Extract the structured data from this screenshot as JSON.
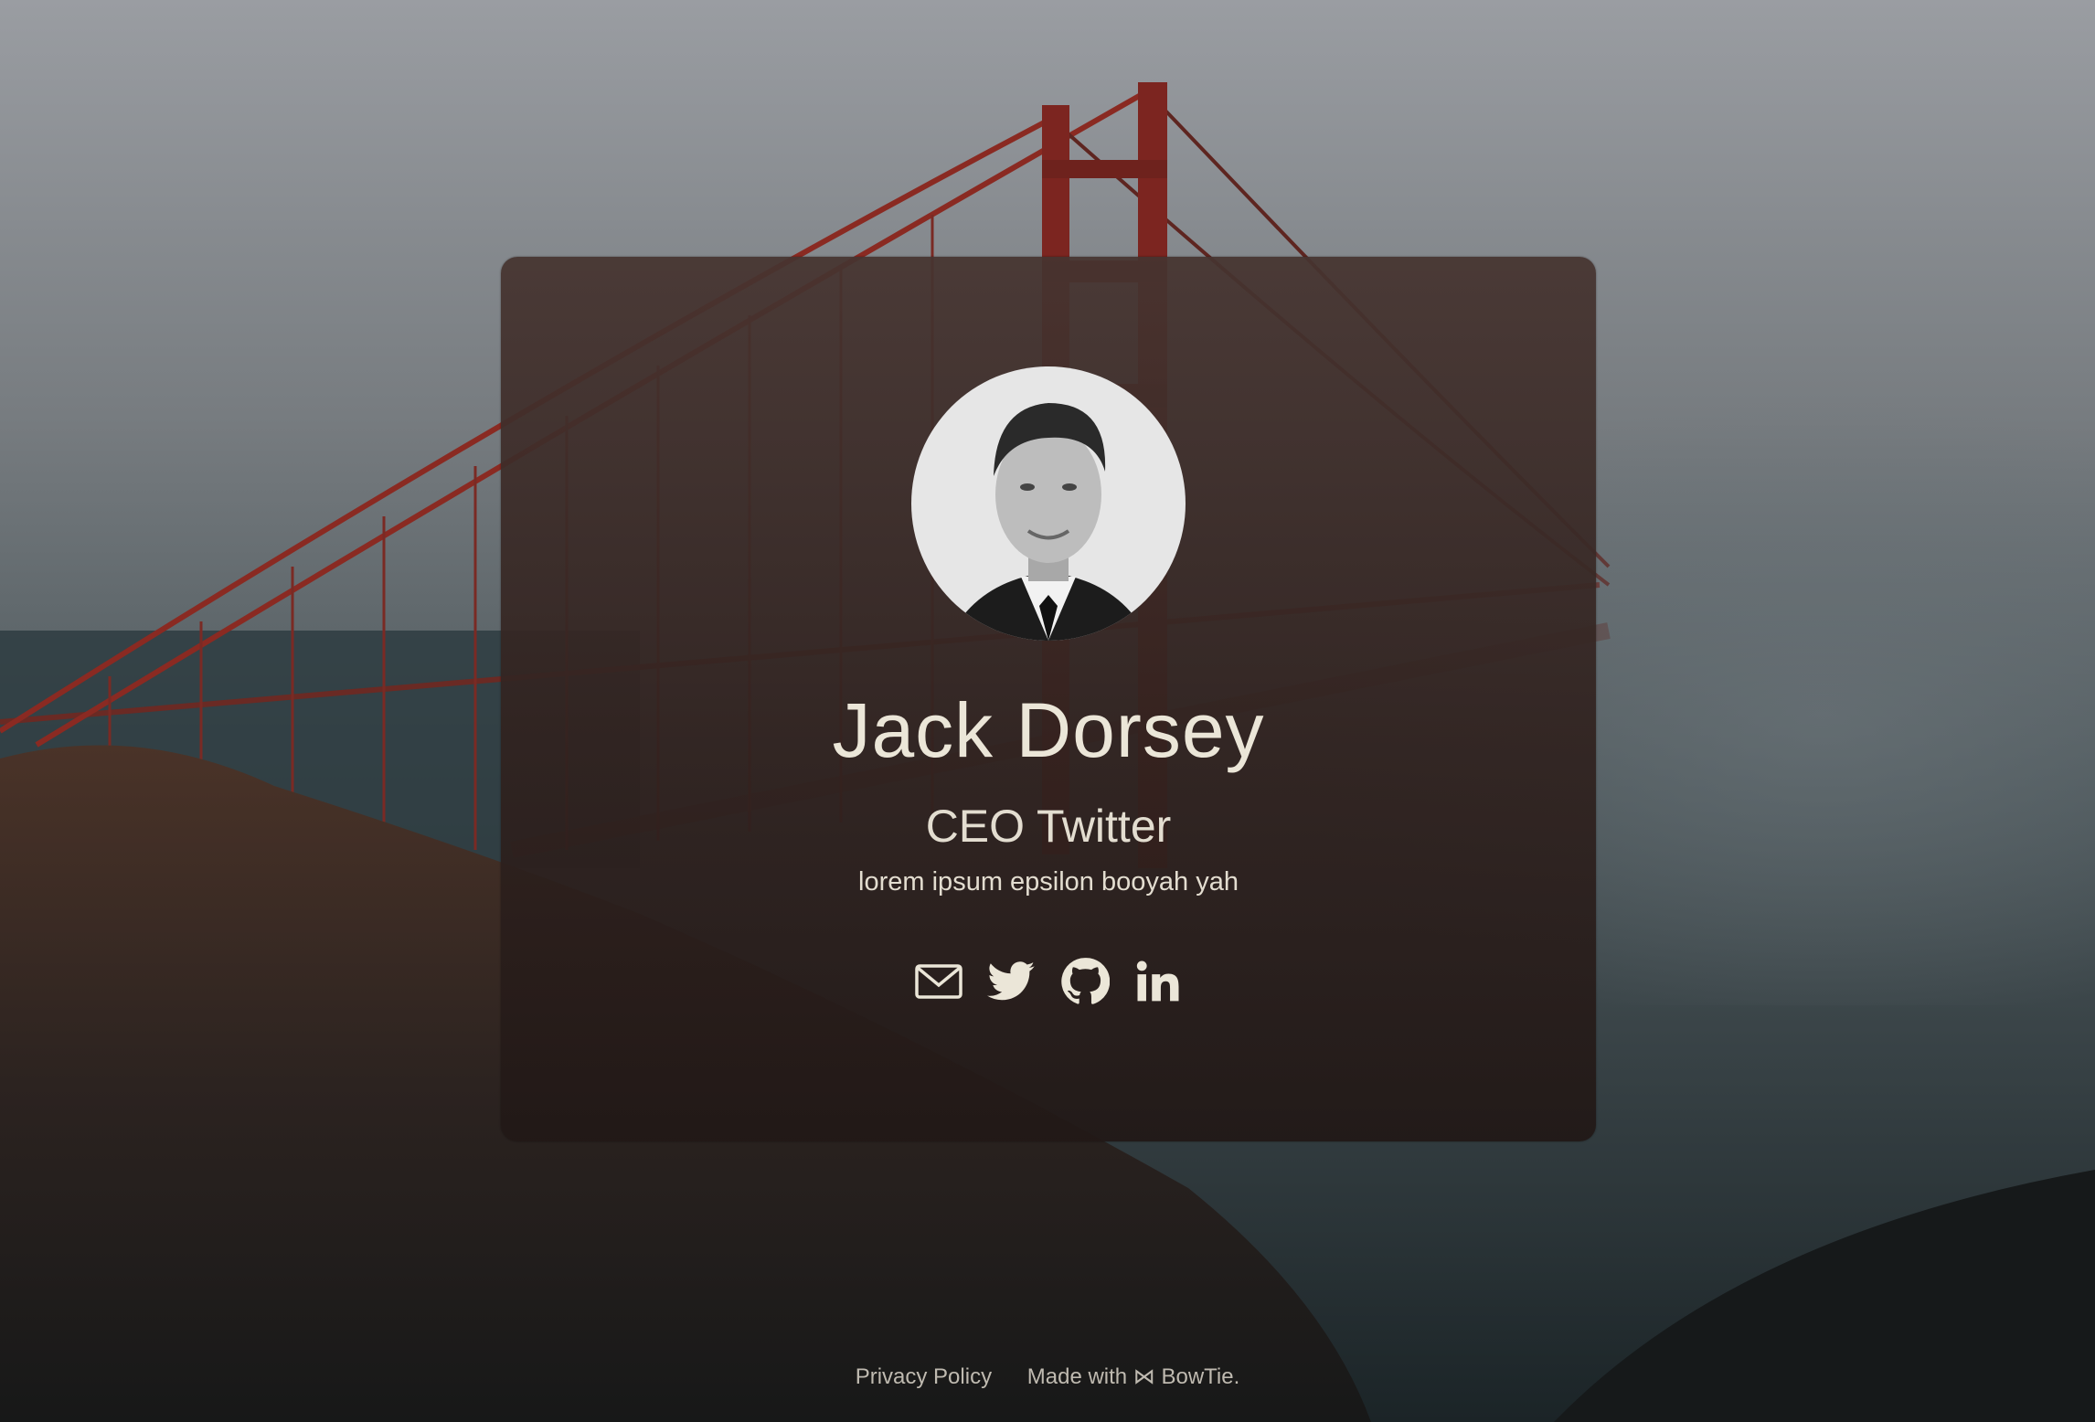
{
  "profile": {
    "name": "Jack Dorsey",
    "title": "CEO Twitter",
    "bio": "lorem ipsum epsilon booyah yah"
  },
  "socials": [
    {
      "icon": "envelope-icon",
      "label": "Email"
    },
    {
      "icon": "twitter-icon",
      "label": "Twitter"
    },
    {
      "icon": "github-icon",
      "label": "GitHub"
    },
    {
      "icon": "linkedin-icon",
      "label": "LinkedIn"
    }
  ],
  "footer": {
    "privacy_label": "Privacy Policy",
    "made_with_label": "Made with ⋈ BowTie."
  },
  "colors": {
    "text": "#ebe6d8",
    "card": "#3f2e2b",
    "bridge": "#8a2a22"
  }
}
